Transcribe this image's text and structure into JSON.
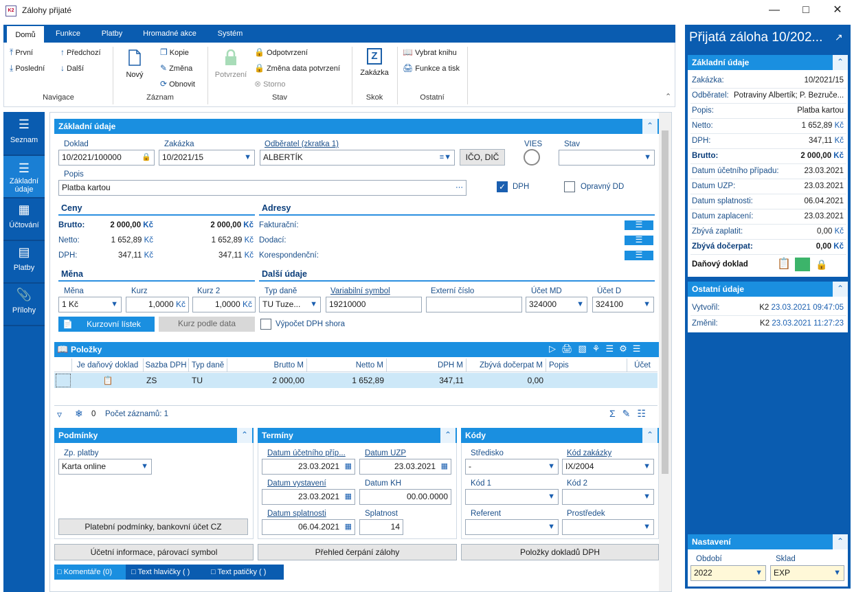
{
  "window": {
    "title": "Zálohy přijaté",
    "app_icon": "K2"
  },
  "ribbon": {
    "tabs": [
      "Domů",
      "Funkce",
      "Platby",
      "Hromadné akce",
      "Systém"
    ],
    "navigace": {
      "prvni": "První",
      "posledni": "Poslední",
      "predchozi": "Předchozí",
      "dalsi": "Další",
      "label": "Navigace"
    },
    "zaznam": {
      "novy": "Nový",
      "kopie": "Kopie",
      "zmena": "Změna",
      "obnovit": "Obnovit",
      "label": "Záznam"
    },
    "stav": {
      "potvrzeni": "Potvrzení",
      "odpotvrzeni": "Odpotvrzení",
      "zmena_data": "Změna data potvrzení",
      "storno": "Storno",
      "label": "Stav"
    },
    "skok": {
      "zakazka": "Zakázka",
      "label": "Skok"
    },
    "ostatni": {
      "vybrat_knihu": "Vybrat knihu",
      "funkce_tisk": "Funkce a tisk",
      "label": "Ostatní"
    }
  },
  "sidebar": [
    {
      "label": "Seznam",
      "icon": "list-icon"
    },
    {
      "label": "Základní údaje",
      "icon": "details-icon"
    },
    {
      "label": "Účtování",
      "icon": "calculator-icon"
    },
    {
      "label": "Platby",
      "icon": "box-icon"
    },
    {
      "label": "Přílohy",
      "icon": "paperclip-icon"
    }
  ],
  "zakladni": {
    "title": "Základní údaje",
    "doklad_label": "Doklad",
    "doklad": "10/2021/100000",
    "zakazka_label": "Zakázka",
    "zakazka": "10/2021/15",
    "odberatel_label": "Odběratel (zkratka 1)",
    "odberatel": "ALBERTÍK",
    "ico_btn": "IČO, DIČ",
    "vies_label": "VIES",
    "stav_label": "Stav",
    "stav": "",
    "popis_label": "Popis",
    "popis": "Platba kartou",
    "dph_label": "DPH",
    "opravny_label": "Opravný DD"
  },
  "ceny": {
    "title": "Ceny",
    "rows": [
      {
        "label": "Brutto:",
        "v1": "2 000,00",
        "v2": "2 000,00"
      },
      {
        "label": "Netto:",
        "v1": "1 652,89",
        "v2": "1 652,89"
      },
      {
        "label": "DPH:",
        "v1": "347,11",
        "v2": "347,11"
      }
    ],
    "currency": "Kč"
  },
  "adresy": {
    "title": "Adresy",
    "rows": [
      "Fakturační:",
      "Dodací:",
      "Korespondenční:"
    ]
  },
  "mena": {
    "title": "Měna",
    "mena_label": "Měna",
    "mena": "1 Kč",
    "kurz_label": "Kurz",
    "kurz": "1,0000",
    "kurz2_label": "Kurz 2",
    "kurz2": "1,0000",
    "kurzovni_btn": "Kurzovní lístek",
    "kurz_data_btn": "Kurz podle data"
  },
  "dalsi": {
    "title": "Další údaje",
    "typ_dane_label": "Typ daně",
    "typ_dane": "TU Tuze...",
    "vs_label": "Variabilní symbol",
    "vs": "19210000",
    "ext_label": "Externí číslo",
    "ext": "",
    "ucet_md_label": "Účet MD",
    "ucet_md": "324000",
    "ucet_d_label": "Účet D",
    "ucet_d": "324100",
    "vypocet_label": "Výpočet DPH shora"
  },
  "polozky": {
    "title": "Položky",
    "columns": [
      "Je daňový doklad",
      "Sazba DPH",
      "Typ daně",
      "Brutto M",
      "Netto M",
      "DPH M",
      "Zbývá dočerpat M",
      "Popis",
      "Účet"
    ],
    "row": {
      "sazba": "ZS",
      "typ": "TU",
      "brutto": "2 000,00",
      "netto": "1 652,89",
      "dph": "347,11",
      "zbyva": "0,00",
      "popis": "",
      "ucet": ""
    },
    "filter_count": "0",
    "pocet": "Počet záznamů: 1"
  },
  "podminky": {
    "title": "Podmínky",
    "zp_label": "Zp. platby",
    "zp": "Karta online",
    "btn": "Platební podmínky, bankovní účet CZ"
  },
  "terminy": {
    "title": "Termíny",
    "ucp_label": "Datum účetního příp...",
    "ucp": "23.03.2021",
    "uzp_label": "Datum UZP",
    "uzp": "23.03.2021",
    "vyst_label": "Datum vystavení",
    "vyst": "23.03.2021",
    "kh_label": "Datum KH",
    "kh": "00.00.0000",
    "splat_label": "Datum splatnosti",
    "splat": "06.04.2021",
    "splatnost_label": "Splatnost",
    "splatnost": "14"
  },
  "kody": {
    "title": "Kódy",
    "stredisko_label": "Středisko",
    "stredisko": "-",
    "kod_zak_label": "Kód zakázky",
    "kod_zak": "IX/2004",
    "kod1_label": "Kód 1",
    "kod1": "",
    "kod2_label": "Kód 2",
    "kod2": "",
    "referent_label": "Referent",
    "referent": "",
    "prostredek_label": "Prostředek",
    "prostredek": ""
  },
  "bottom_buttons": [
    "Účetní informace, párovací symbol",
    "Přehled čerpání zálohy",
    "Položky dokladů DPH"
  ],
  "bottom_tabs": [
    "Komentáře (0)",
    "Text hlavičky ( )",
    "Text patičky ( )"
  ],
  "right": {
    "title": "Přijatá záloha 10/202...",
    "zakladni_title": "Základní údaje",
    "rows": [
      {
        "l": "Zakázka:",
        "v": "10/2021/15"
      },
      {
        "l": "Odběratel:",
        "v": "Potraviny Albertík; P. Bezruče..."
      },
      {
        "l": "Popis:",
        "v": "Platba kartou"
      },
      {
        "l": "Netto:",
        "v": "1 652,89",
        "cur": "Kč"
      },
      {
        "l": "DPH:",
        "v": "347,11",
        "cur": "Kč"
      },
      {
        "l": "Brutto:",
        "v": "2 000,00",
        "cur": "Kč"
      },
      {
        "l": "Datum účetního případu:",
        "v": "23.03.2021"
      },
      {
        "l": "Datum UZP:",
        "v": "23.03.2021"
      },
      {
        "l": "Datum splatnosti:",
        "v": "06.04.2021"
      },
      {
        "l": "Datum zaplacení:",
        "v": "23.03.2021"
      },
      {
        "l": "Zbývá zaplatit:",
        "v": "0,00",
        "cur": "Kč"
      },
      {
        "l": "Zbývá dočerpat:",
        "v": "0,00",
        "cur": "Kč"
      }
    ],
    "danovy": "Daňový doklad",
    "ostatni_title": "Ostatní údaje",
    "vytvoril_l": "Vytvořil:",
    "vytvoril_u": "K2",
    "vytvoril_d": "23.03.2021 09:47:05",
    "zmenil_l": "Změnil:",
    "zmenil_u": "K2",
    "zmenil_d": "23.03.2021 11:27:23",
    "nastaveni_title": "Nastavení",
    "obdobi_label": "Období",
    "obdobi": "2022",
    "sklad_label": "Sklad",
    "sklad": "EXP"
  }
}
